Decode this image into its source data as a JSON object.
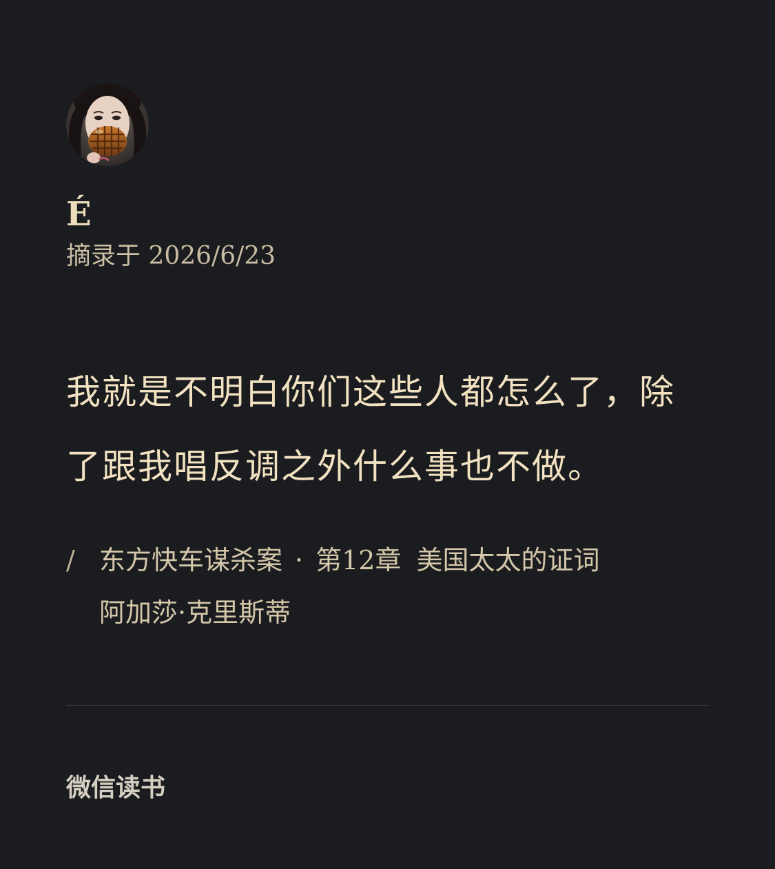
{
  "theme": {
    "background": "#1b1c1f",
    "accent_text": "#f2e2c1",
    "muted_text": "#c9bda3",
    "divider": "#3b3c40"
  },
  "user": {
    "avatar_icon": "user-avatar-photo",
    "name": "É"
  },
  "excerpt": {
    "date_line": "摘录于 2026/6/23",
    "quote": "我就是不明白你们这些人都怎么了，除了跟我唱反调之外什么事也不做。"
  },
  "source": {
    "slash": "/",
    "book_title": "东方快车谋杀案",
    "separator": "·",
    "chapter": "第12章",
    "chapter_title": "美国太太的证词",
    "author": "阿加莎·克里斯蒂"
  },
  "footer": {
    "brand": "微信读书"
  }
}
